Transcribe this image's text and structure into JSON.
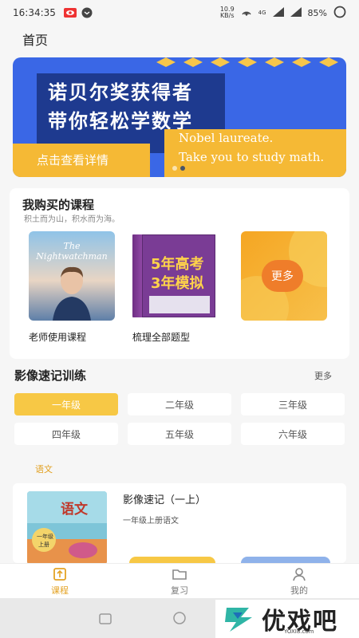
{
  "status_bar": {
    "time": "16:34:35",
    "net_speed_value": "10.9",
    "net_speed_unit": "KB/s",
    "network": "4G",
    "battery": "85%"
  },
  "header": {
    "title": "首页"
  },
  "banner": {
    "headline_line1": "诺贝尔奖获得者",
    "headline_line2": "带你轻松学数学",
    "cta": "点击查看详情",
    "english_line1": "Nobel laureate.",
    "english_line2": "Take you to study math."
  },
  "purchased": {
    "title": "我购买的课程",
    "subtitle": "积土而为山，积水而为海。",
    "courses": [
      {
        "label": "老师使用课程",
        "cover_text": "The Nightwatchman"
      },
      {
        "label": "梳理全部题型",
        "cover_line1": "5年高考",
        "cover_line2": "3年模拟"
      },
      {
        "label": "",
        "cover_text": "更多"
      }
    ]
  },
  "training": {
    "title": "影像速记训练",
    "more": "更多",
    "grades": [
      "一年级",
      "二年级",
      "三年级",
      "四年级",
      "五年级",
      "六年级"
    ],
    "active_grade": "一年级"
  },
  "subject_section": {
    "subject": "语文",
    "course": {
      "name": "影像速记（一上）",
      "desc": "一年级上册语文",
      "cover_title": "语文",
      "cover_sub": "一年级",
      "cover_sub2": "上册"
    }
  },
  "tabbar": {
    "tabs": [
      {
        "label": "课程",
        "icon": "book-icon"
      },
      {
        "label": "复习",
        "icon": "folder-icon"
      },
      {
        "label": "我的",
        "icon": "person-icon"
      }
    ],
    "active": "课程"
  },
  "watermark": {
    "text": "优戏吧",
    "url": "YOXI8.com"
  },
  "colors": {
    "accent": "#f7c845",
    "banner_blue": "#3a67e6",
    "banner_dark": "#1e3a8f",
    "tab_active": "#e4a325"
  }
}
